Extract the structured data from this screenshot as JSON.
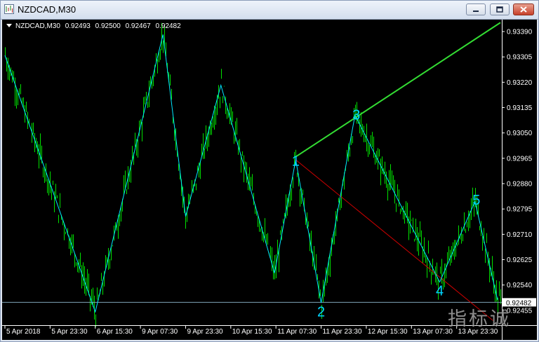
{
  "window": {
    "title": "NZDCAD,M30",
    "controls": [
      "minimize",
      "restore",
      "close"
    ]
  },
  "chart_header": {
    "symbol": "NZDCAD,M30",
    "open": "0.92493",
    "high": "0.92500",
    "low": "0.92467",
    "close": "0.92482"
  },
  "colors": {
    "background": "#000000",
    "bars": "#00e000",
    "zigzag": "#00e5ff",
    "trendline_upper": "#33dd33",
    "trendline_lower": "#cc0000",
    "bid_line": "#7fa4b8",
    "axis_text": "#ffffff",
    "wave_labels": "#00d4ff"
  },
  "icons": {
    "app": "chart-icon",
    "header_arrow": "triangle-down-icon"
  },
  "chart_data": {
    "type": "candlestick",
    "symbol": "NZDCAD",
    "timeframe": "M30",
    "y_ticks": [
      "0.93390",
      "0.93305",
      "0.93220",
      "0.93135",
      "0.93050",
      "0.92965",
      "0.92880",
      "0.92795",
      "0.92710",
      "0.92625",
      "0.92540",
      "0.92455"
    ],
    "ylim": [
      0.9241,
      0.9343
    ],
    "current_price": "0.92482",
    "x_ticks": [
      "5 Apr 2018",
      "5 Apr 23:30",
      "6 Apr 15:30",
      "9 Apr 07:30",
      "9 Apr 23:30",
      "10 Apr 15:30",
      "11 Apr 07:30",
      "11 Apr 23:30",
      "12 Apr 15:30",
      "13 Apr 07:30",
      "13 Apr 23:30"
    ],
    "x_tick_index": [
      0,
      32,
      64,
      96,
      128,
      160,
      192,
      224,
      256,
      288,
      320
    ],
    "zigzag": [
      {
        "index": 0,
        "price": 0.9331
      },
      {
        "index": 64,
        "price": 0.9245
      },
      {
        "index": 112,
        "price": 0.9338
      },
      {
        "index": 128,
        "price": 0.9277
      },
      {
        "index": 153,
        "price": 0.9321
      },
      {
        "index": 191,
        "price": 0.9258
      },
      {
        "index": 206,
        "price": 0.9296
      },
      {
        "index": 224,
        "price": 0.9248
      },
      {
        "index": 248,
        "price": 0.9311
      },
      {
        "index": 308,
        "price": 0.9255
      },
      {
        "index": 333,
        "price": 0.9282
      },
      {
        "index": 349,
        "price": 0.9249
      }
    ],
    "wave_labels": [
      {
        "text": "1",
        "index": 206,
        "price": 0.9294
      },
      {
        "text": "2",
        "index": 224,
        "price": 0.92435
      },
      {
        "text": "3",
        "index": 249,
        "price": 0.93095
      },
      {
        "text": "4",
        "index": 308,
        "price": 0.92505
      },
      {
        "text": "5",
        "index": 334,
        "price": 0.9281
      }
    ],
    "trendlines": [
      {
        "name": "upper",
        "from": {
          "index": 206,
          "price": 0.9297
        },
        "to": {
          "index": 351,
          "price": 0.9342
        }
      },
      {
        "name": "lower",
        "from": {
          "index": 206,
          "price": 0.9296
        },
        "to": {
          "index": 346,
          "price": 0.9242
        }
      }
    ]
  },
  "watermark": "指标诚"
}
